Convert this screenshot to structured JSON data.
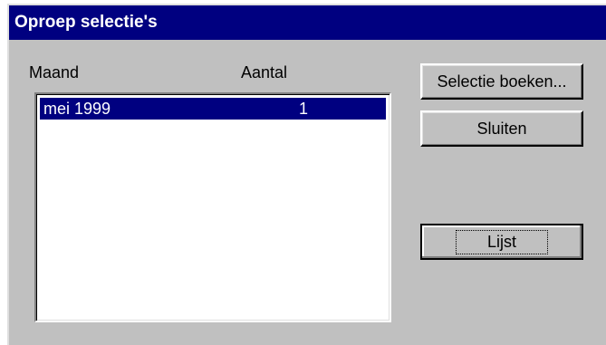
{
  "window": {
    "title": "Oproep selectie's"
  },
  "list": {
    "headers": {
      "month": "Maand",
      "count": "Aantal"
    },
    "rows": [
      {
        "month": "mei 1999",
        "count": "1"
      }
    ]
  },
  "buttons": {
    "book": "Selectie boeken...",
    "close": "Sluiten",
    "list": "Lijst"
  },
  "colors": {
    "titlebar": "#000080",
    "selection": "#000080",
    "face": "#c0c0c0"
  }
}
